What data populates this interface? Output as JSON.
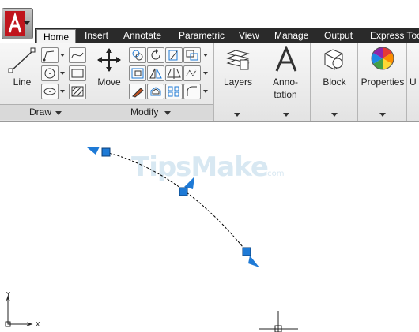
{
  "tabs": [
    {
      "label": "Home",
      "active": true
    },
    {
      "label": "Insert"
    },
    {
      "label": "Annotate"
    },
    {
      "label": "Parametric"
    },
    {
      "label": "View"
    },
    {
      "label": "Manage"
    },
    {
      "label": "Output"
    },
    {
      "label": "Express Too"
    }
  ],
  "panels": {
    "draw": {
      "title": "Draw",
      "line_label": "Line"
    },
    "modify": {
      "title": "Modify",
      "move_label": "Move"
    },
    "layers": {
      "label": "Layers"
    },
    "annotation": {
      "label_line1": "Anno-",
      "label_line2": "tation"
    },
    "block": {
      "label": "Block"
    },
    "properties": {
      "label": "Properties"
    },
    "utilities": {
      "label": "U"
    }
  },
  "watermark": {
    "main": "TipsMake",
    "suffix": ".com"
  },
  "ucs": {
    "x_label": "X",
    "y_label": "Y"
  },
  "colors": {
    "accent": "#1e7ad6",
    "tabbar": "#2a2a2a",
    "logo_red": "#c0141c"
  }
}
